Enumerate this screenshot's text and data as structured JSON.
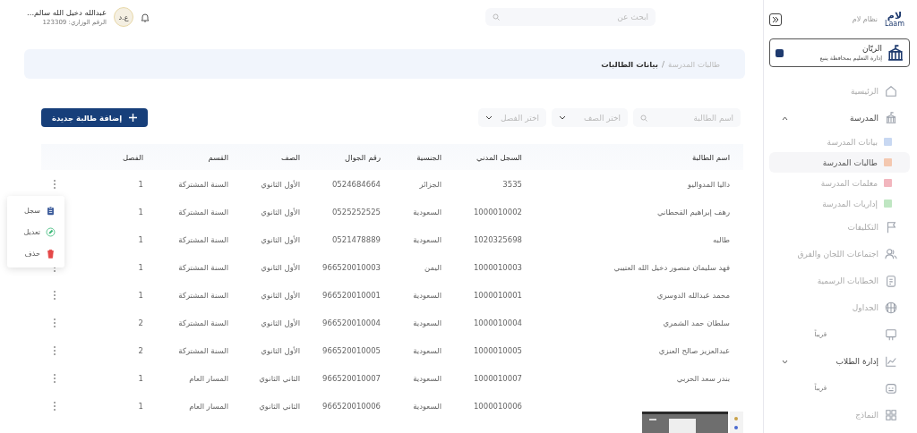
{
  "sidebar": {
    "logo": "لام",
    "logo_latin": "Laam",
    "system_name": "نظام لام",
    "school": {
      "name": "الريّان",
      "subtitle": "إدارة التعليم بمحافظة ينبع"
    },
    "items": [
      {
        "label": "الرئيسية"
      },
      {
        "label": "المدرسة",
        "expanded": true,
        "children": [
          {
            "label": "بيانات المدرسة",
            "color": "#c8d8f2",
            "selected": false
          },
          {
            "label": "طالبات المدرسة",
            "color": "#f4c8b0",
            "selected": true
          },
          {
            "label": "معلمات المدرسة",
            "color": "#f2b6be",
            "selected": false
          },
          {
            "label": "إداريات المدرسة",
            "color": "#bfe6c2",
            "selected": false
          }
        ]
      },
      {
        "label": "التكليفات"
      },
      {
        "label": "اجتماعات اللجان والفرق"
      },
      {
        "label": "الخطابات الرسمية"
      },
      {
        "label": "الجداول"
      },
      {
        "badge": "قريباً"
      },
      {
        "label": "إدارة الطلاب",
        "expanded": false
      },
      {
        "badge": "قريباً"
      },
      {
        "label": "النماذج"
      }
    ]
  },
  "header": {
    "search": {
      "placeholder": "ابحث عن"
    },
    "user": {
      "initials": "ع.د",
      "name": "عبدالله دخيل الله سالم...",
      "subtitle": "الرقم الوزاري: 123309"
    }
  },
  "breadcrumb": {
    "separator": "/",
    "items": [
      {
        "label": "طالبات المدرسة",
        "selected": false
      },
      {
        "label": "بيانات الطالبات",
        "selected": true
      }
    ]
  },
  "filters": {
    "name": {
      "placeholder": "اسم الطالبة"
    },
    "grade": {
      "placeholder": "اختر الصف"
    },
    "class": {
      "placeholder": "اختر الفصل"
    }
  },
  "add_button": {
    "label": "إضافة طالبة جديدة"
  },
  "table": {
    "columns": [
      "اسم الطالبة",
      "السجل المدني",
      "الجنسية",
      "رقم الجوال",
      "الصف",
      "القسم",
      "الفصل"
    ],
    "rows": [
      {
        "cells": [
          "داليا المدواليو",
          "3535",
          "الجزائر",
          "0524684664",
          "الأول الثانوي",
          "السنة المشتركة",
          "1"
        ]
      },
      {
        "cells": [
          "رهف إبراهيم القحطاني",
          "1000010002",
          "السعودية",
          "0525252525",
          "الأول الثانوي",
          "السنة المشتركة",
          "1"
        ]
      },
      {
        "cells": [
          "طالبه",
          "1020325698",
          "السعودية",
          "0521478889",
          "الأول الثانوي",
          "السنة المشتركة",
          "1"
        ]
      },
      {
        "cells": [
          "فهد سليمان منصور دخيل الله العتيبي",
          "1000010003",
          "اليمن",
          "966520010003",
          "الأول الثانوي",
          "السنة المشتركة",
          "1"
        ]
      },
      {
        "cells": [
          "محمد عبدالله الدوسري",
          "1000010001",
          "السعودية",
          "966520010001",
          "الأول الثانوي",
          "السنة المشتركة",
          "1"
        ]
      },
      {
        "cells": [
          "سلطان حمد الشمري",
          "1000010004",
          "السعودية",
          "966520010004",
          "الأول الثانوي",
          "السنة المشتركة",
          "2"
        ]
      },
      {
        "cells": [
          "عبدالعزيز صالح العنزي",
          "1000010005",
          "السعودية",
          "966520010005",
          "الأول الثانوي",
          "السنة المشتركة",
          "2"
        ]
      },
      {
        "cells": [
          "بندر سعد الحربي",
          "1000010007",
          "السعودية",
          "966520010007",
          "الثاني الثانوي",
          "المسار العام",
          "1"
        ]
      },
      {
        "cells": [
          null,
          "1000010006",
          "السعودية",
          "966520010006",
          "الثاني الثانوي",
          "المسار العام",
          "1"
        ]
      }
    ]
  },
  "row_menu": {
    "items": [
      {
        "label": "سجل"
      },
      {
        "label": "تعديل"
      },
      {
        "label": "حذف"
      }
    ]
  }
}
